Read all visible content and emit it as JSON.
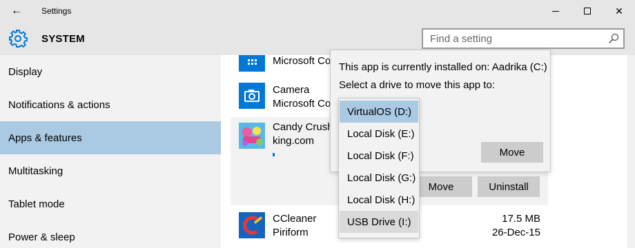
{
  "window": {
    "title": "Settings",
    "back_glyph": "←",
    "close_glyph": "✕"
  },
  "header": {
    "section": "SYSTEM",
    "search_placeholder": "Find a setting"
  },
  "sidebar": {
    "items": [
      {
        "label": "Display"
      },
      {
        "label": "Notifications & actions"
      },
      {
        "label": "Apps & features",
        "selected": true
      },
      {
        "label": "Multitasking"
      },
      {
        "label": "Tablet mode"
      },
      {
        "label": "Power & sleep"
      }
    ]
  },
  "apps": [
    {
      "name": "",
      "publisher": "Microsoft Co"
    },
    {
      "name": "Camera",
      "publisher": "Microsoft Co"
    },
    {
      "name": "Candy Crush",
      "publisher": "king.com"
    },
    {
      "name": "CCleaner",
      "publisher": "Piriform",
      "size": "17.5 MB",
      "date": "26-Dec-15"
    }
  ],
  "candy_buttons": {
    "move": "Move",
    "uninstall": "Uninstall"
  },
  "flyout": {
    "installed_on": "This app is currently installed on: Aadrika (C:)",
    "select_prompt": "Select a drive to move this app to:",
    "move_button": "Move"
  },
  "drives": [
    {
      "label": "VirtualOS (D:)",
      "state": "selected"
    },
    {
      "label": "Local Disk (E:)"
    },
    {
      "label": "Local Disk (F:)"
    },
    {
      "label": "Local Disk (G:)"
    },
    {
      "label": "Local Disk (H:)"
    },
    {
      "label": "USB Drive (I:)",
      "state": "hover"
    }
  ],
  "colors": {
    "accent": "#0078d7",
    "selection": "#aac9e2",
    "chrome": "#e6e6e6"
  }
}
